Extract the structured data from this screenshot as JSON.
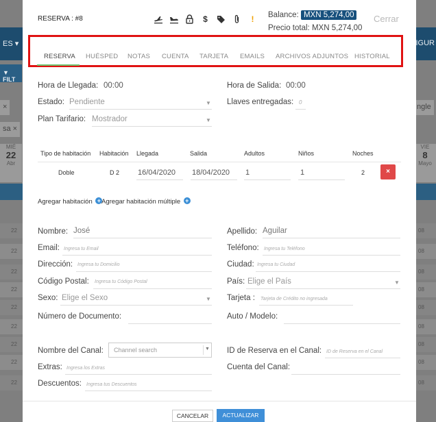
{
  "background": {
    "nav_left": "ES ▾",
    "nav_right": "FIGUR",
    "filter_label": "▼ FILT",
    "chip_left_1": "×",
    "chip_left_2": "sa ×",
    "chip_right": "ngle",
    "cal_left": {
      "day": "MIÉ",
      "date": "22",
      "month": "Abr"
    },
    "cal_right": {
      "day": "VIE",
      "date": "8",
      "month": "Mayo"
    },
    "row_left_values": [
      "22",
      "22",
      "22",
      "22",
      "22",
      "22",
      "22",
      "22",
      "22"
    ],
    "row_right_values": [
      "08",
      "08",
      "08",
      "08",
      "08",
      "08",
      "08",
      "08",
      "08"
    ]
  },
  "header": {
    "reservation_label": "RESERVA : #8",
    "icons": [
      "plane-depart-icon",
      "plane-arrive-icon",
      "lock-icon",
      "dollar-icon",
      "tag-icon",
      "paperclip-icon",
      "warning-icon"
    ],
    "balance_label": "Balance:",
    "balance_value": "MXN 5,274,00",
    "total_label": "Precio total:",
    "total_value": "MXN 5,274,00",
    "close_label": "Cerrar"
  },
  "tabs": [
    {
      "label": "RESERVA",
      "active": true
    },
    {
      "label": "HUÉSPED",
      "active": false
    },
    {
      "label": "NOTAS",
      "active": false
    },
    {
      "label": "CUENTA",
      "active": false
    },
    {
      "label": "TARJETA",
      "active": false
    },
    {
      "label": "EMAILS",
      "active": false
    },
    {
      "label": "ARCHIVOS ADJUNTOS",
      "active": false
    },
    {
      "label": "HISTORIAL",
      "active": false
    }
  ],
  "stay": {
    "arrival_label": "Hora de Llegada:",
    "arrival_value": "00:00",
    "departure_label": "Hora de Salida:",
    "departure_value": "00:00",
    "status_label": "Estado:",
    "status_value": "Pendiente",
    "keys_label": "Llaves entregadas:",
    "keys_value": "0",
    "rate_label": "Plan Tarifario:",
    "rate_value": "Mostrador"
  },
  "rooms_table": {
    "headers": [
      "Tipo de habitación",
      "Habitación",
      "Llegada",
      "Salida",
      "Adultos",
      "Niños",
      "Noches"
    ],
    "rows": [
      {
        "type": "Doble",
        "room": "D 2",
        "arrival": "16/04/2020",
        "departure": "18/04/2020",
        "adults": "1",
        "children": "1",
        "nights": "2"
      }
    ],
    "delete_icon": "×"
  },
  "room_links": {
    "add_room": "Agregar habitación",
    "add_multiple": "Agregar habitación múltiple"
  },
  "guest": {
    "name_label": "Nombre:",
    "name_value": "José",
    "lastname_label": "Apellido:",
    "lastname_value": "Aguilar",
    "email_label": "Email:",
    "email_placeholder": "Ingresa tu Email",
    "phone_label": "Teléfono:",
    "phone_placeholder": "Ingresa tu Teléfono",
    "address_label": "Dirección:",
    "address_placeholder": "Ingresa tu Domicilio",
    "city_label": "Ciudad:",
    "city_placeholder": "Ingresa tu Ciudad",
    "zip_label": "Código Postal:",
    "zip_placeholder": "Ingresa tu Código Postal",
    "country_label": "País:",
    "country_value": "Elige el País",
    "sex_label": "Sexo:",
    "sex_value": "Elige el Sexo",
    "card_label": "Tarjeta :",
    "card_placeholder": "Tarjeta de Crédito no ingresada",
    "doc_label": "Número de Documento:",
    "car_label": "Auto / Modelo:"
  },
  "channel": {
    "channel_label": "Nombre del Canal:",
    "channel_placeholder": "Channel search",
    "channel_res_label": "ID de Reserva en el Canal:",
    "channel_res_placeholder": "ID de Reserva en el Canal",
    "extras_label": "Extras:",
    "extras_placeholder": "Ingresa los Extras",
    "channel_account_label": "Cuenta del Canal:",
    "discount_label": "Descuentos:",
    "discount_placeholder": "Ingresa tus Descuentos"
  },
  "footer": {
    "cancel_label": "CANCELAR",
    "update_label": "ACTUALIZAR"
  }
}
